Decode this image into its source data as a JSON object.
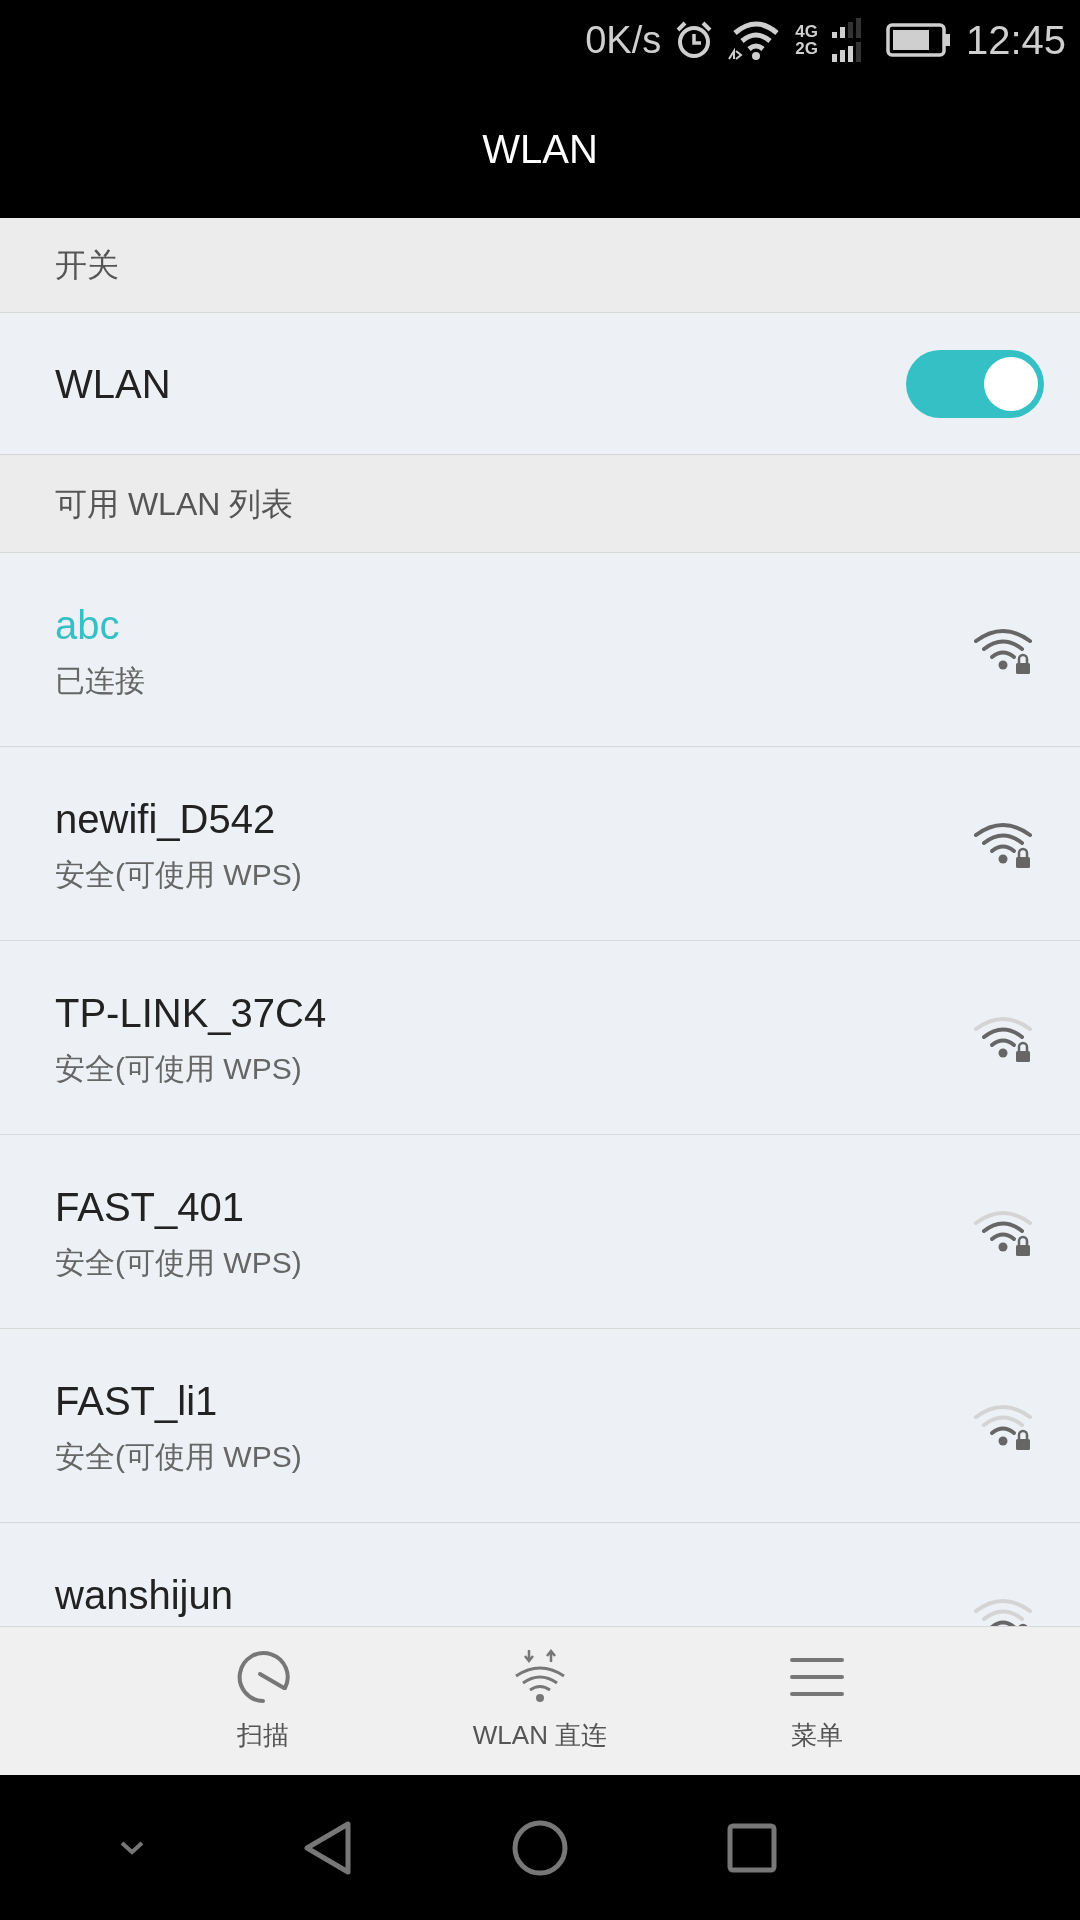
{
  "status_bar": {
    "speed": "0K/s",
    "network_4g": "4G",
    "network_2g": "2G",
    "time": "12:45"
  },
  "header": {
    "title": "WLAN"
  },
  "sections": [
    {
      "title": "开关"
    },
    {
      "title": "可用 WLAN 列表"
    }
  ],
  "wlan_switch": {
    "label": "WLAN",
    "on": true
  },
  "networks": [
    {
      "name": "abc",
      "status": "已连接",
      "connected": true,
      "kind": "strong"
    },
    {
      "name": "newifi_D542",
      "status": "安全(可使用 WPS)",
      "connected": false,
      "kind": "strong"
    },
    {
      "name": "TP-LINK_37C4",
      "status": "安全(可使用 WPS)",
      "connected": false,
      "kind": "medium"
    },
    {
      "name": "FAST_401",
      "status": "安全(可使用 WPS)",
      "connected": false,
      "kind": "medium"
    },
    {
      "name": "FAST_li1",
      "status": "安全(可使用 WPS)",
      "connected": false,
      "kind": "weak"
    },
    {
      "name": "wanshijun",
      "connected": false,
      "kind": "weak"
    }
  ],
  "toolbar": [
    {
      "kind": "scan",
      "label": "扫描"
    },
    {
      "kind": "direct",
      "label": "WLAN 直连"
    },
    {
      "kind": "menu",
      "label": "菜单"
    }
  ]
}
